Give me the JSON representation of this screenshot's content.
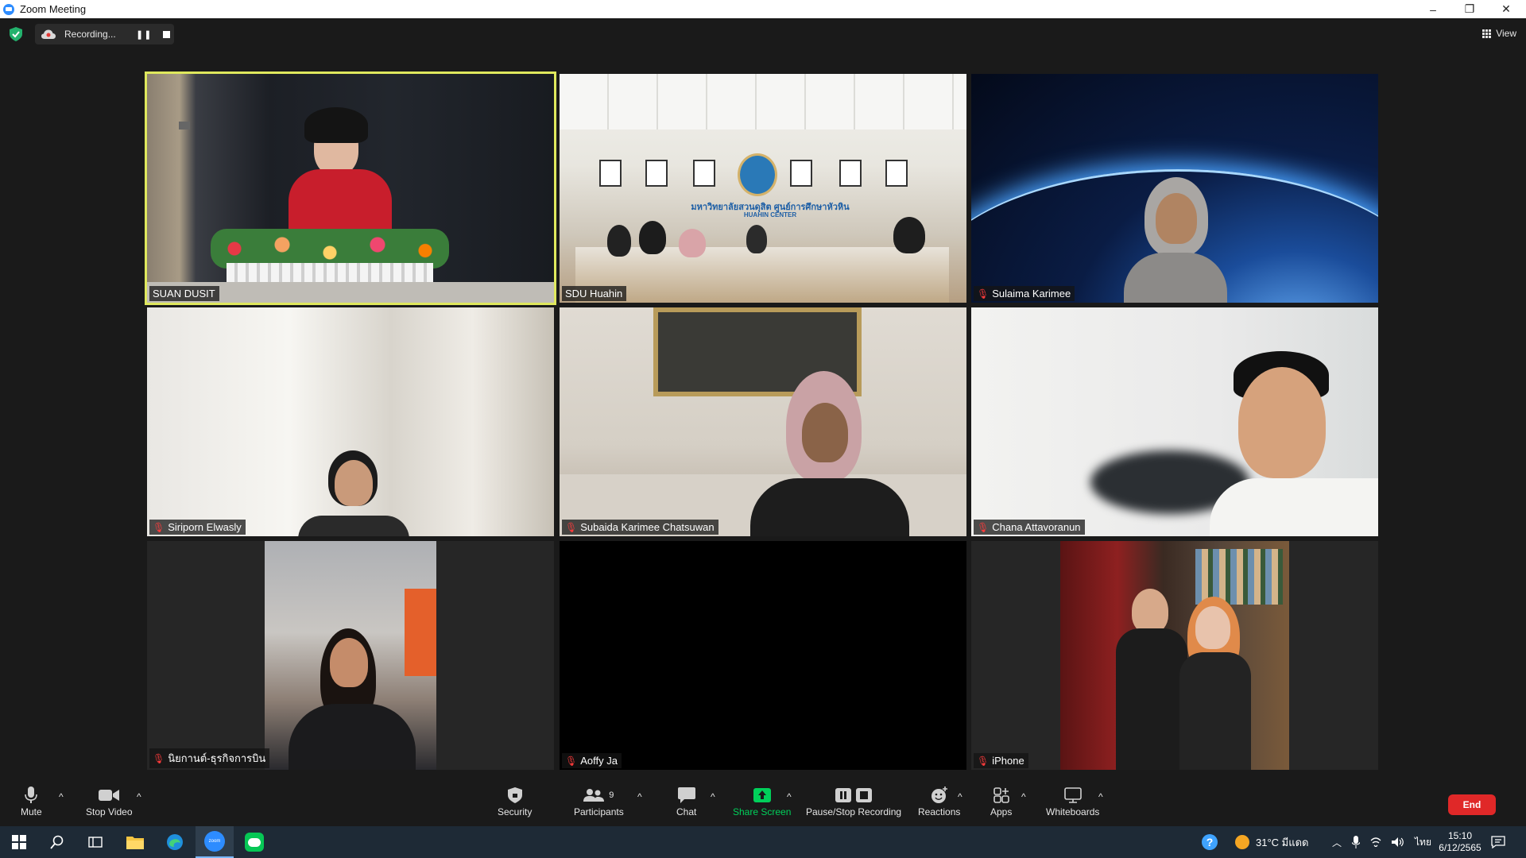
{
  "window": {
    "title": "Zoom Meeting",
    "minimize": "–",
    "restore": "❐",
    "close": "✕"
  },
  "topbar": {
    "recording_text": "Recording...",
    "pause_symbol": "❚❚",
    "view_label": "View"
  },
  "participants": [
    {
      "name": "SUAN DUSIT",
      "muted": false,
      "active_speaker": true
    },
    {
      "name": "SDU Huahin",
      "muted": false,
      "active_speaker": false
    },
    {
      "name": "Sulaima Karimee",
      "muted": true,
      "active_speaker": false
    },
    {
      "name": "Siriporn Elwasly",
      "muted": true,
      "active_speaker": false
    },
    {
      "name": "Subaida Karimee Chatsuwan",
      "muted": true,
      "active_speaker": false
    },
    {
      "name": "Chana Attavoranun",
      "muted": true,
      "active_speaker": false
    },
    {
      "name": "นิยกานต์-ธุรกิจการบิน",
      "muted": true,
      "active_speaker": false
    },
    {
      "name": "Aoffy Ja",
      "muted": true,
      "active_speaker": false
    },
    {
      "name": "iPhone",
      "muted": true,
      "active_speaker": false
    }
  ],
  "slide_text": {
    "line1": "มหาวิทยาลัยสวนดุสิต ศูนย์การศึกษาหัวหิน",
    "line2": "HUAHIN CENTER"
  },
  "toolbar": {
    "mute": "Mute",
    "stop_video": "Stop Video",
    "security": "Security",
    "participants": "Participants",
    "participants_count": "9",
    "chat": "Chat",
    "share_screen": "Share Screen",
    "pause_stop_recording": "Pause/Stop Recording",
    "reactions": "Reactions",
    "apps": "Apps",
    "whiteboards": "Whiteboards",
    "end": "End",
    "caret": "^"
  },
  "taskbar": {
    "weather": "31°C มีแดด",
    "language": "ไทย",
    "time": "15:10",
    "date": "6/12/2565",
    "zoom_app_label": "zoom"
  },
  "colors": {
    "speaker_highlight": "#dfe85d",
    "end_button": "#e02828",
    "share_green": "#00d05a",
    "muted_red": "#ff3b3b"
  }
}
